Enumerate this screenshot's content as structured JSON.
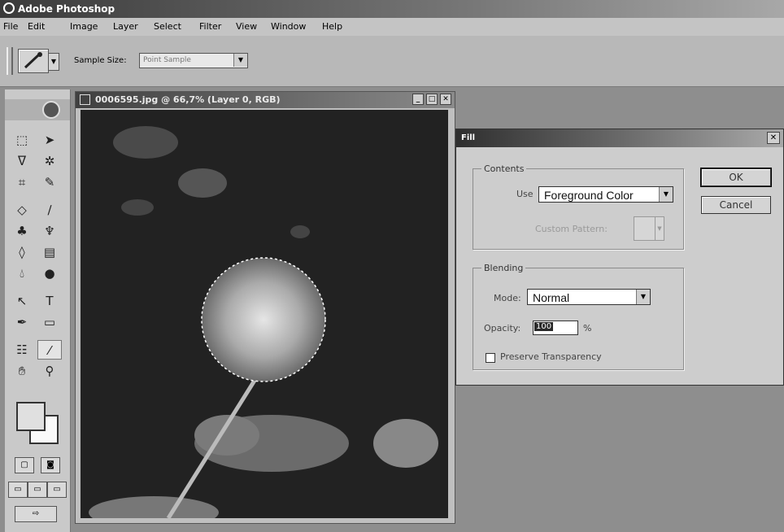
{
  "app": {
    "title": "Adobe Photoshop"
  },
  "menu": [
    "File",
    "Edit",
    "Image",
    "Layer",
    "Select",
    "Filter",
    "View",
    "Window",
    "Help"
  ],
  "options": {
    "sample_size_label": "Sample Size:",
    "sample_size_value": "Point Sample"
  },
  "document": {
    "title": "0006595.jpg @ 66,7% (Layer 0, RGB)"
  },
  "fill_dialog": {
    "title": "Fill",
    "contents_legend": "Contents",
    "use_label": "Use",
    "use_value": "Foreground Color",
    "custom_pattern_label": "Custom Pattern:",
    "blending_legend": "Blending",
    "mode_label": "Mode:",
    "mode_value": "Normal",
    "opacity_label": "Opacity:",
    "opacity_value": "100",
    "opacity_unit": "%",
    "preserve_label": "Preserve Transparency",
    "preserve_checked": false,
    "ok_label": "OK",
    "cancel_label": "Cancel"
  }
}
